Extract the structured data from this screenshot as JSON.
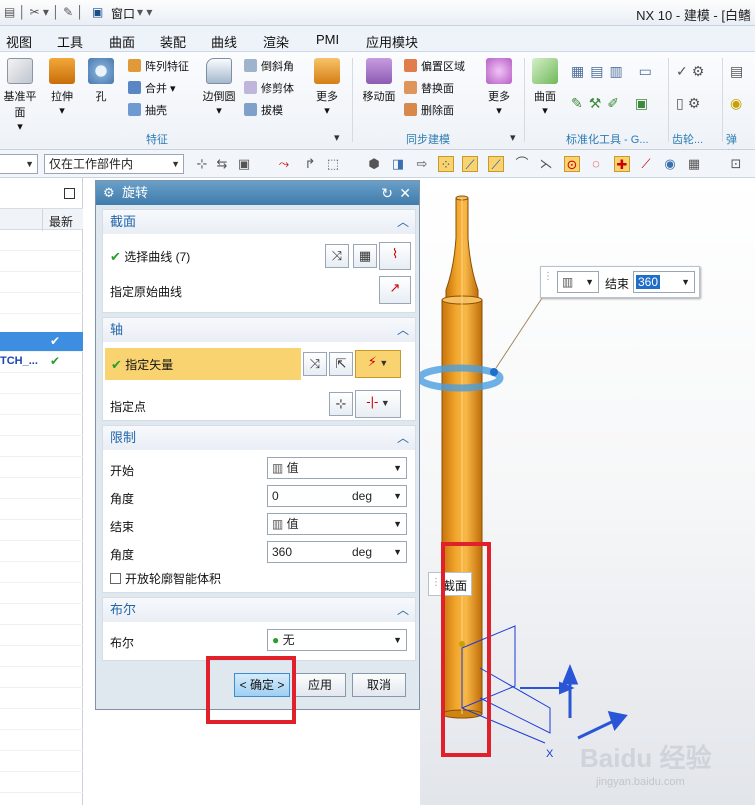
{
  "titlebar": {
    "quick_window": "窗口",
    "title": "NX 10 - 建模 - [白鳍"
  },
  "menubar": {
    "items": [
      "视图",
      "工具",
      "曲面",
      "装配",
      "曲线",
      "渲染",
      "PMI",
      "应用模块"
    ]
  },
  "ribbon": {
    "datum_plane": "基准平面",
    "extrude": "拉伸",
    "hole": "孔",
    "pattern_feature": "阵列特征",
    "unite": "合并",
    "shell": "抽壳",
    "edge_blend": "边倒圆",
    "chamfer": "倒斜角",
    "trim_body": "修剪体",
    "draft": "拔模",
    "more1": "更多",
    "group_feature": "特征",
    "move_face": "移动面",
    "offset_region": "偏置区域",
    "replace_face": "替换面",
    "delete_face": "删除面",
    "more2": "更多",
    "group_sync": "同步建模",
    "surface": "曲面",
    "group_std": "标准化工具 - G...",
    "group_gear": "齿轮...",
    "group_spring": "弹簧..."
  },
  "toolbar": {
    "filter_value": "",
    "scope_value": "仅在工作部件内"
  },
  "navigator": {
    "col_latest": "最新",
    "row_label": "TCH_..."
  },
  "dialog": {
    "title": "旋转",
    "section": {
      "header": "截面",
      "select_curve": "选择曲线 (7)",
      "origin_curve": "指定原始曲线"
    },
    "axis": {
      "header": "轴",
      "vector": "指定矢量",
      "point": "指定点"
    },
    "limits": {
      "header": "限制",
      "start_label": "开始",
      "start_value": "值",
      "start_angle_label": "角度",
      "start_angle": "0",
      "unit1": "deg",
      "end_label": "结束",
      "end_value": "值",
      "end_angle_label": "角度",
      "end_angle": "360",
      "unit2": "deg",
      "open_profile": "开放轮廓智能体积"
    },
    "boolean": {
      "header": "布尔",
      "label": "布尔",
      "value": "无"
    },
    "ok": "< 确定 >",
    "apply": "应用",
    "cancel": "取消"
  },
  "viewport": {
    "end_label": "结束",
    "end_value": "360",
    "section_tag": "截面",
    "axis_x": "X"
  },
  "watermark": {
    "brand": "Baidu 经验",
    "url": "jingyan.baidu.com"
  },
  "colors": {
    "part": "#e99a1e",
    "highlight": "#f8d36f",
    "red_box": "#e0202a",
    "accent": "#2266a8"
  }
}
